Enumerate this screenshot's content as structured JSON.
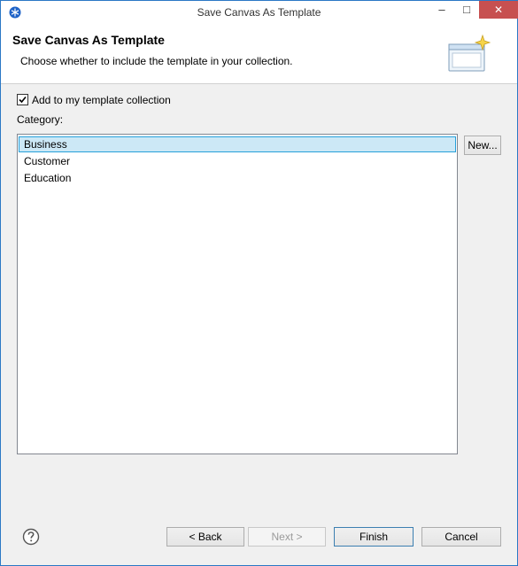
{
  "window": {
    "title": "Save Canvas As Template",
    "minimize": "–",
    "maximize": "□",
    "close": "✕"
  },
  "header": {
    "title": "Save Canvas As Template",
    "description": "Choose whether to include the template in your collection."
  },
  "form": {
    "add_checkbox_label": "Add to my template collection",
    "add_checkbox_checked": true,
    "category_label": "Category:",
    "categories": [
      "Business",
      "Customer",
      "Education"
    ],
    "selected_category": "Business",
    "new_button": "New..."
  },
  "footer": {
    "back": "< Back",
    "next": "Next >",
    "finish": "Finish",
    "cancel": "Cancel"
  },
  "colors": {
    "selection_bg": "#cce8f6",
    "selection_border": "#26a0da",
    "close_button": "#c75050",
    "window_border": "#2b78c5"
  },
  "icons": {
    "app": "snowflake-icon",
    "wizard": "wizard-banner-icon",
    "help": "help-icon"
  }
}
